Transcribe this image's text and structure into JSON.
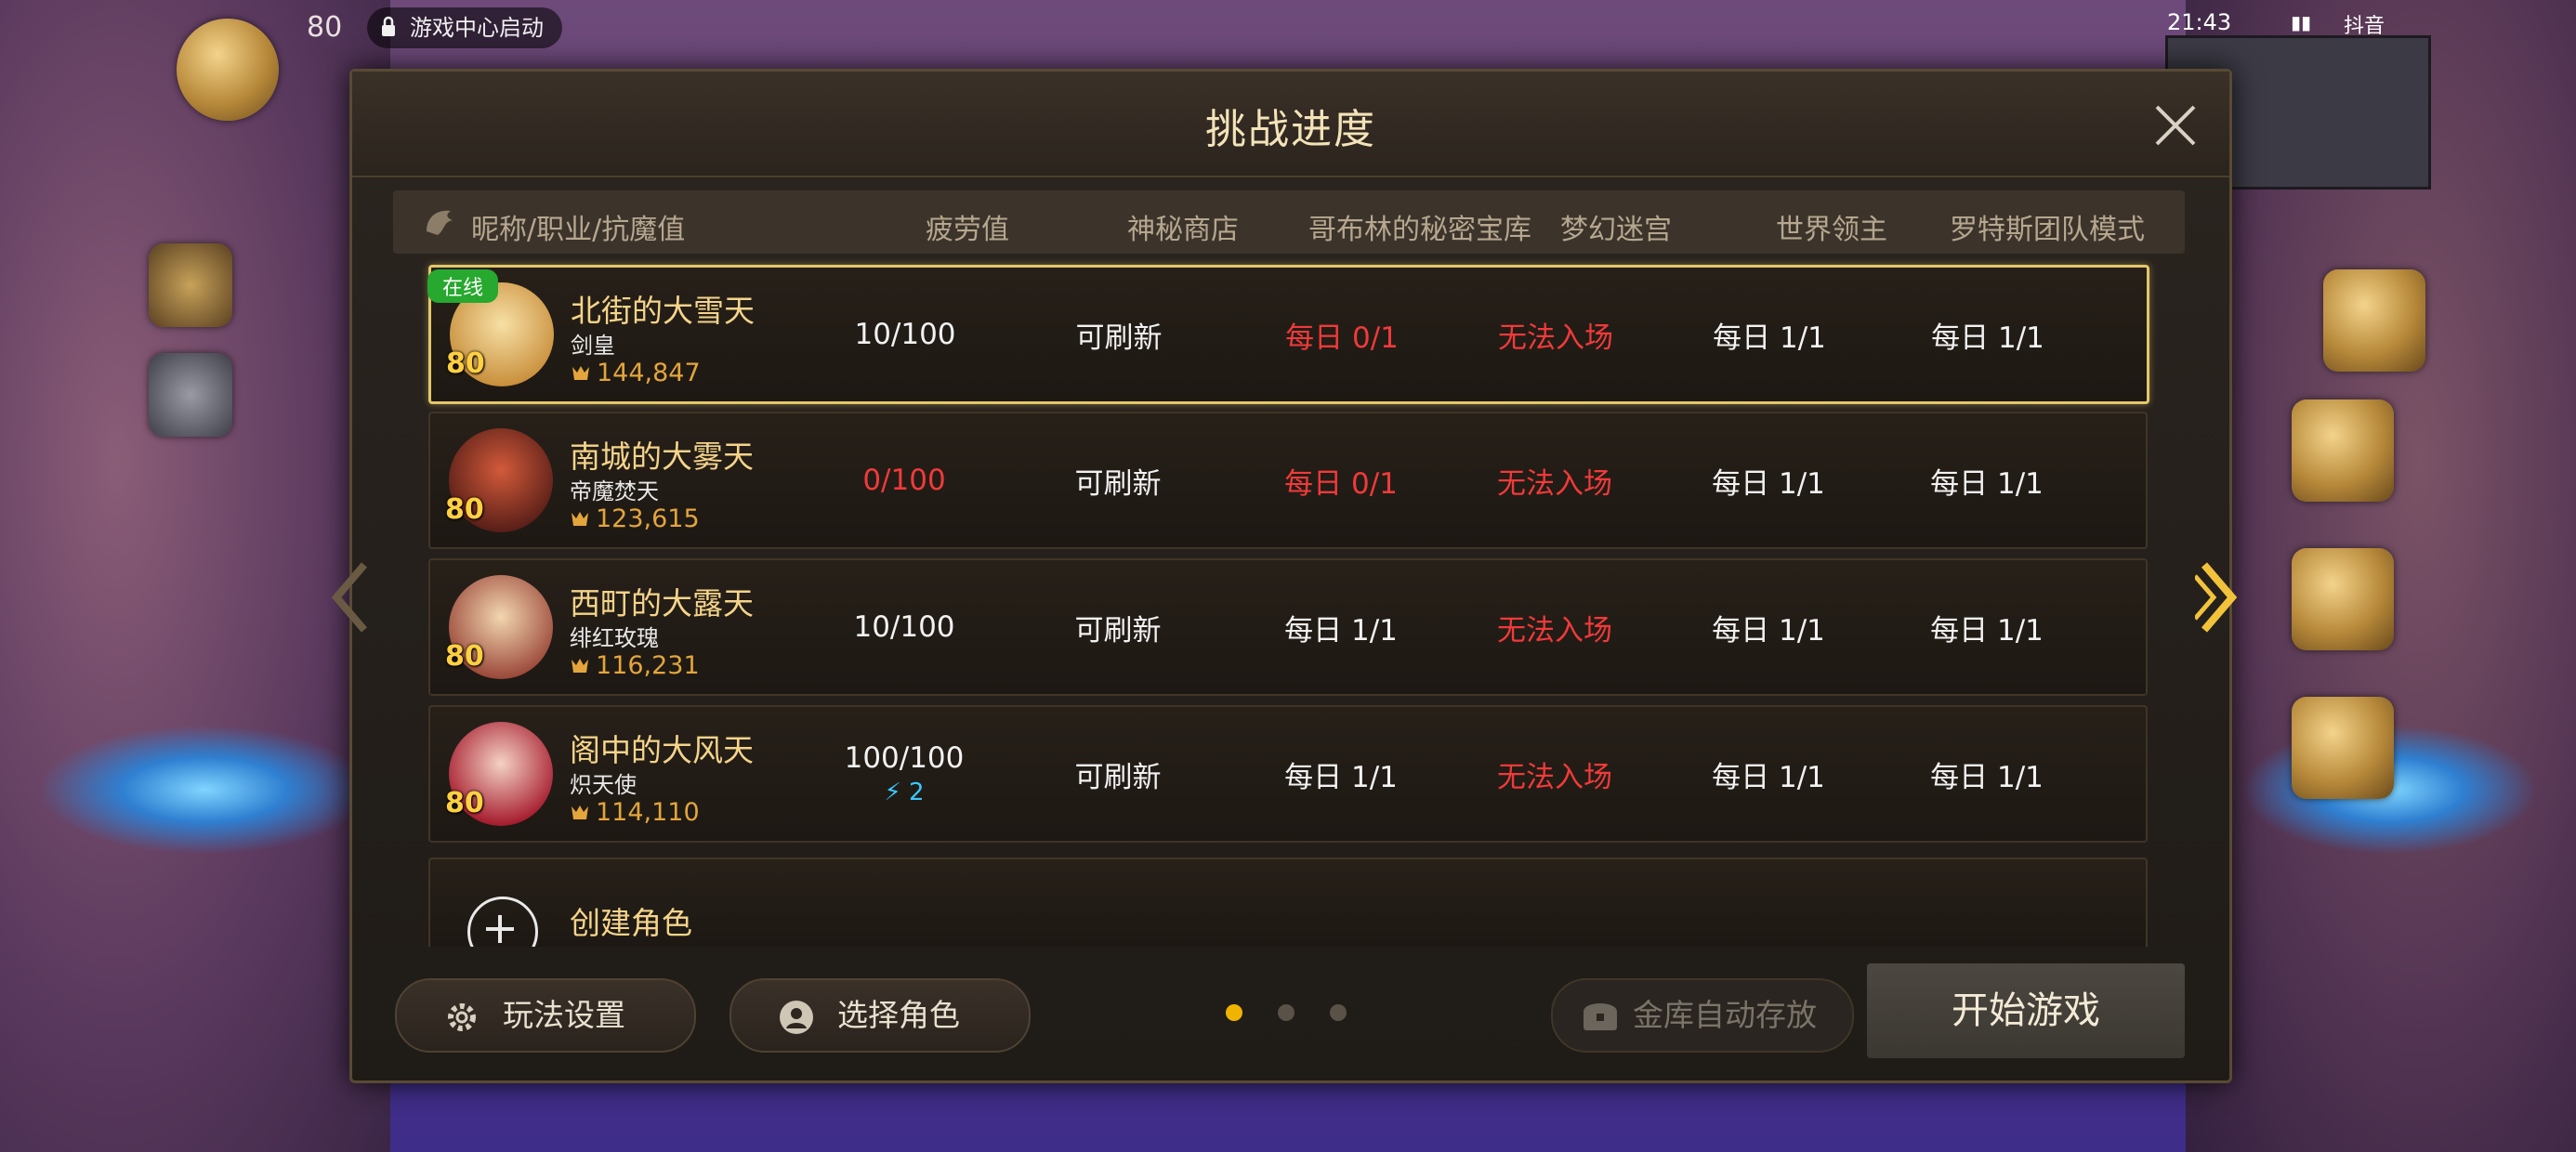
{
  "status_bar": {
    "level": "80",
    "game_center_label": "游戏中心启动",
    "time": "21:43",
    "right_text": "抖音"
  },
  "modal": {
    "title": "挑战进度",
    "columns": [
      "昵称/职业/抗魔值",
      "疲劳值",
      "神秘商店",
      "哥布林的秘密宝库",
      "梦幻迷宫",
      "世界领主",
      "罗特斯团队模式"
    ],
    "characters": [
      {
        "online_label": "在线",
        "level": "80",
        "name": "北街的大雪天",
        "class": "剑皇",
        "power": "144,847",
        "fatigue": "10/100",
        "fatigue_red": false,
        "fatigue_extra": "",
        "shop": "可刷新",
        "goblin": "每日 0/1",
        "goblin_red": true,
        "maze": "无法入场",
        "maze_red": true,
        "world_boss": "每日 1/1",
        "lotus": "每日 1/1"
      },
      {
        "online_label": "",
        "level": "80",
        "name": "南城的大雾天",
        "class": "帝魔焚天",
        "power": "123,615",
        "fatigue": "0/100",
        "fatigue_red": true,
        "fatigue_extra": "",
        "shop": "可刷新",
        "goblin": "每日 0/1",
        "goblin_red": true,
        "maze": "无法入场",
        "maze_red": true,
        "world_boss": "每日 1/1",
        "lotus": "每日 1/1"
      },
      {
        "online_label": "",
        "level": "80",
        "name": "西町的大露天",
        "class": "绯红玫瑰",
        "power": "116,231",
        "fatigue": "10/100",
        "fatigue_red": false,
        "fatigue_extra": "",
        "shop": "可刷新",
        "goblin": "每日 1/1",
        "goblin_red": false,
        "maze": "无法入场",
        "maze_red": true,
        "world_boss": "每日 1/1",
        "lotus": "每日 1/1"
      },
      {
        "online_label": "",
        "level": "80",
        "name": "阁中的大风天",
        "class": "炽天使",
        "power": "114,110",
        "fatigue": "100/100",
        "fatigue_red": false,
        "fatigue_extra": "2",
        "shop": "可刷新",
        "goblin": "每日 1/1",
        "goblin_red": false,
        "maze": "无法入场",
        "maze_red": true,
        "world_boss": "每日 1/1",
        "lotus": "每日 1/1"
      }
    ],
    "create_label": "创建角色",
    "footer": {
      "settings_label": "玩法设置",
      "select_char_label": "选择角色",
      "auto_save_label": "金库自动存放",
      "start_label": "开始游戏",
      "page_count": 3,
      "active_page": 0
    }
  },
  "colors": {
    "title_gold": "#f3e3b8",
    "name_gold": "#f5d48a",
    "red": "#f03a3a",
    "online_green": "#27a82e",
    "power_orange": "#e3a53c",
    "selected_border": "#e3c768",
    "dot_active": "#f0b400"
  }
}
